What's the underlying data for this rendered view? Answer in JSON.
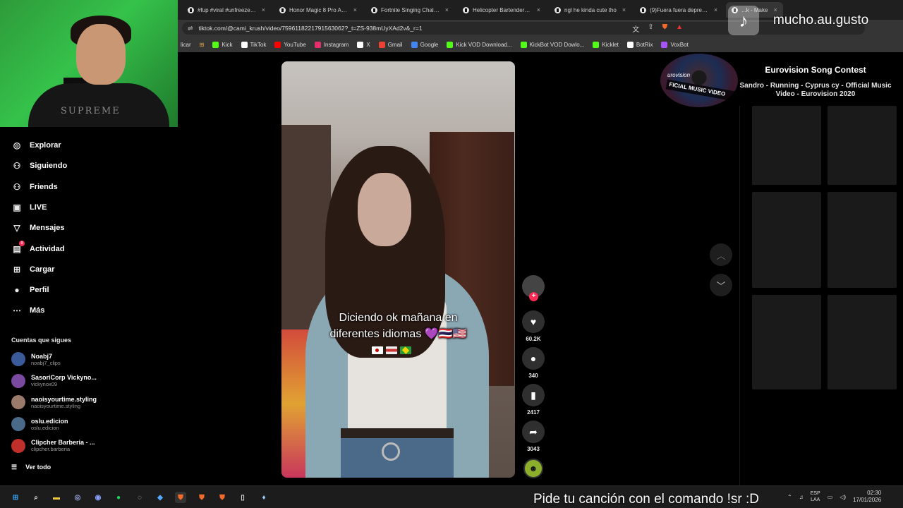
{
  "webcam": {
    "shirt_text": "SUPREME"
  },
  "browser": {
    "tabs": [
      {
        "label": "#fup #viral #unfreezemyac",
        "active": false
      },
      {
        "label": "Honor Magic 8 Pro Air llega",
        "active": false
      },
      {
        "label": "Fortnite Singing Challenge",
        "active": false
      },
      {
        "label": "Helicopter Bartender's Un",
        "active": false
      },
      {
        "label": "ngl he kinda cute tho",
        "active": false
      },
      {
        "label": "(9)Fuera fuera depresión",
        "active": false
      },
      {
        "label": "...k - Make",
        "active": true
      }
    ],
    "url": "tiktok.com/@cami_krush/video/7596118221791563062?_t=ZS-938mUyXAd2v&_r=1",
    "bookmarks": [
      "licar",
      "Kick",
      "TikTok",
      "YouTube",
      "Instagram",
      "X",
      "Gmail",
      "Google",
      "Kick VOD Download...",
      "KickBot VOD Dowlo...",
      "Kicklet",
      "BotRix",
      "VoxBot"
    ]
  },
  "overlay": {
    "text": "mucho.au.gusto"
  },
  "song": {
    "title": "Eurovision Song Contest",
    "subtitle": "Sandro - Running - Cyprus cy - Official Music Video - Eurovision 2020",
    "disc_label": "FICIAL MUSIC VIDEO",
    "disc_logo": "urovision"
  },
  "sidebar": {
    "nav": [
      {
        "label": "Explorar",
        "icon": "compass-icon"
      },
      {
        "label": "Siguiendo",
        "icon": "following-icon"
      },
      {
        "label": "Friends",
        "icon": "friends-icon"
      },
      {
        "label": "LIVE",
        "icon": "live-icon"
      },
      {
        "label": "Mensajes",
        "icon": "messages-icon"
      },
      {
        "label": "Actividad",
        "icon": "activity-icon",
        "badge": "9"
      },
      {
        "label": "Cargar",
        "icon": "upload-icon"
      },
      {
        "label": "Perfil",
        "icon": "profile-icon"
      },
      {
        "label": "Más",
        "icon": "more-icon"
      }
    ],
    "following_title": "Cuentas que sigues",
    "accounts": [
      {
        "name": "Noabj7",
        "handle": "noabj7_clips",
        "color": "#3b5a9a"
      },
      {
        "name": "SasoriCorp Vickyno...",
        "handle": "vickynox09",
        "color": "#7a4aa0"
      },
      {
        "name": "naoisyourtime.styling",
        "handle": "naoisyourtime.styling",
        "color": "#9a7a6a"
      },
      {
        "name": "oslu.edicion",
        "handle": "oslu.edicion",
        "color": "#4a6a8a"
      },
      {
        "name": "Clipcher Barberia - ...",
        "handle": "clipcher.barberia",
        "color": "#c0302a"
      }
    ],
    "see_all": "Ver todo"
  },
  "video": {
    "caption_line1": "Diciendo ok mañana en",
    "caption_line2": "diferentes idiomas 💜🇹🇭🇺🇸"
  },
  "actions": {
    "likes": "60.2K",
    "comments": "340",
    "saves": "2417",
    "shares": "3043"
  },
  "taskbar": {
    "ticker": "Pide tu canción con el comando !sr :D",
    "lang_top": "ESP",
    "lang_bottom": "LAA",
    "time": "02:30",
    "date": "17/01/2026"
  },
  "colors": {
    "accent": "#fe2c55",
    "background": "#000000"
  }
}
